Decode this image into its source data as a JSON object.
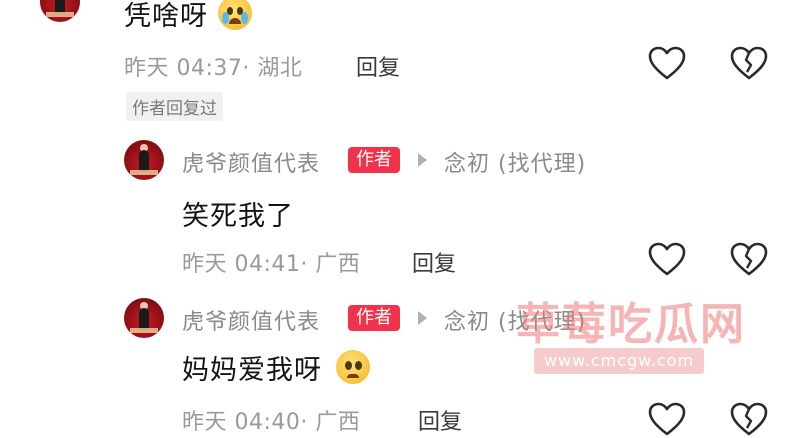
{
  "comments": [
    {
      "text": "凭啥呀",
      "meta": "昨天 04:37· 湖北",
      "reply_label": "回复",
      "tag": "作者回复过"
    },
    {
      "username": "虎爷颜值代表",
      "badge": "作者",
      "reply_to": "念初 (找代理)",
      "text": "笑死我了",
      "meta": "昨天 04:41· 广西",
      "reply_label": "回复"
    },
    {
      "username": "虎爷颜值代表",
      "badge": "作者",
      "reply_to": "念初 (找代理)",
      "text": "妈妈爱我呀",
      "meta": "昨天 04:40· 广西",
      "reply_label": "回复"
    }
  ],
  "watermark": {
    "main": "草莓吃瓜网",
    "sub": "www.cmcgw.com"
  },
  "icons": {
    "like": "heart-outline-icon",
    "dislike": "broken-heart-icon"
  },
  "colors": {
    "badge": "#f0324a",
    "meta": "#9a9a9a",
    "watermark": "#ec7878"
  }
}
